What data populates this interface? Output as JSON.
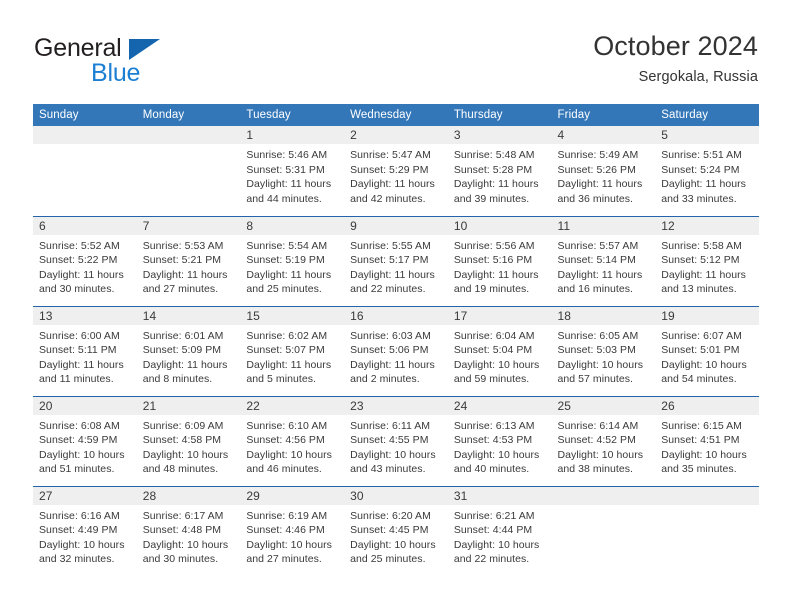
{
  "brand": {
    "name_part1": "General",
    "name_part2": "Blue",
    "triangle_color": "#1565ae",
    "blue_color": "#1c7fd3"
  },
  "header": {
    "title": "October 2024",
    "subtitle": "Sergokala, Russia"
  },
  "theme": {
    "header_blue": "#3477b8",
    "row_divider_blue": "#2265ac",
    "daynum_band": "#efefef",
    "text": "#3a3a3a"
  },
  "columns": [
    "Sunday",
    "Monday",
    "Tuesday",
    "Wednesday",
    "Thursday",
    "Friday",
    "Saturday"
  ],
  "weeks": [
    [
      {
        "day": "",
        "lines": []
      },
      {
        "day": "",
        "lines": []
      },
      {
        "day": "1",
        "lines": [
          "Sunrise: 5:46 AM",
          "Sunset: 5:31 PM",
          "Daylight: 11 hours",
          "and 44 minutes."
        ]
      },
      {
        "day": "2",
        "lines": [
          "Sunrise: 5:47 AM",
          "Sunset: 5:29 PM",
          "Daylight: 11 hours",
          "and 42 minutes."
        ]
      },
      {
        "day": "3",
        "lines": [
          "Sunrise: 5:48 AM",
          "Sunset: 5:28 PM",
          "Daylight: 11 hours",
          "and 39 minutes."
        ]
      },
      {
        "day": "4",
        "lines": [
          "Sunrise: 5:49 AM",
          "Sunset: 5:26 PM",
          "Daylight: 11 hours",
          "and 36 minutes."
        ]
      },
      {
        "day": "5",
        "lines": [
          "Sunrise: 5:51 AM",
          "Sunset: 5:24 PM",
          "Daylight: 11 hours",
          "and 33 minutes."
        ]
      }
    ],
    [
      {
        "day": "6",
        "lines": [
          "Sunrise: 5:52 AM",
          "Sunset: 5:22 PM",
          "Daylight: 11 hours",
          "and 30 minutes."
        ]
      },
      {
        "day": "7",
        "lines": [
          "Sunrise: 5:53 AM",
          "Sunset: 5:21 PM",
          "Daylight: 11 hours",
          "and 27 minutes."
        ]
      },
      {
        "day": "8",
        "lines": [
          "Sunrise: 5:54 AM",
          "Sunset: 5:19 PM",
          "Daylight: 11 hours",
          "and 25 minutes."
        ]
      },
      {
        "day": "9",
        "lines": [
          "Sunrise: 5:55 AM",
          "Sunset: 5:17 PM",
          "Daylight: 11 hours",
          "and 22 minutes."
        ]
      },
      {
        "day": "10",
        "lines": [
          "Sunrise: 5:56 AM",
          "Sunset: 5:16 PM",
          "Daylight: 11 hours",
          "and 19 minutes."
        ]
      },
      {
        "day": "11",
        "lines": [
          "Sunrise: 5:57 AM",
          "Sunset: 5:14 PM",
          "Daylight: 11 hours",
          "and 16 minutes."
        ]
      },
      {
        "day": "12",
        "lines": [
          "Sunrise: 5:58 AM",
          "Sunset: 5:12 PM",
          "Daylight: 11 hours",
          "and 13 minutes."
        ]
      }
    ],
    [
      {
        "day": "13",
        "lines": [
          "Sunrise: 6:00 AM",
          "Sunset: 5:11 PM",
          "Daylight: 11 hours",
          "and 11 minutes."
        ]
      },
      {
        "day": "14",
        "lines": [
          "Sunrise: 6:01 AM",
          "Sunset: 5:09 PM",
          "Daylight: 11 hours",
          "and 8 minutes."
        ]
      },
      {
        "day": "15",
        "lines": [
          "Sunrise: 6:02 AM",
          "Sunset: 5:07 PM",
          "Daylight: 11 hours",
          "and 5 minutes."
        ]
      },
      {
        "day": "16",
        "lines": [
          "Sunrise: 6:03 AM",
          "Sunset: 5:06 PM",
          "Daylight: 11 hours",
          "and 2 minutes."
        ]
      },
      {
        "day": "17",
        "lines": [
          "Sunrise: 6:04 AM",
          "Sunset: 5:04 PM",
          "Daylight: 10 hours",
          "and 59 minutes."
        ]
      },
      {
        "day": "18",
        "lines": [
          "Sunrise: 6:05 AM",
          "Sunset: 5:03 PM",
          "Daylight: 10 hours",
          "and 57 minutes."
        ]
      },
      {
        "day": "19",
        "lines": [
          "Sunrise: 6:07 AM",
          "Sunset: 5:01 PM",
          "Daylight: 10 hours",
          "and 54 minutes."
        ]
      }
    ],
    [
      {
        "day": "20",
        "lines": [
          "Sunrise: 6:08 AM",
          "Sunset: 4:59 PM",
          "Daylight: 10 hours",
          "and 51 minutes."
        ]
      },
      {
        "day": "21",
        "lines": [
          "Sunrise: 6:09 AM",
          "Sunset: 4:58 PM",
          "Daylight: 10 hours",
          "and 48 minutes."
        ]
      },
      {
        "day": "22",
        "lines": [
          "Sunrise: 6:10 AM",
          "Sunset: 4:56 PM",
          "Daylight: 10 hours",
          "and 46 minutes."
        ]
      },
      {
        "day": "23",
        "lines": [
          "Sunrise: 6:11 AM",
          "Sunset: 4:55 PM",
          "Daylight: 10 hours",
          "and 43 minutes."
        ]
      },
      {
        "day": "24",
        "lines": [
          "Sunrise: 6:13 AM",
          "Sunset: 4:53 PM",
          "Daylight: 10 hours",
          "and 40 minutes."
        ]
      },
      {
        "day": "25",
        "lines": [
          "Sunrise: 6:14 AM",
          "Sunset: 4:52 PM",
          "Daylight: 10 hours",
          "and 38 minutes."
        ]
      },
      {
        "day": "26",
        "lines": [
          "Sunrise: 6:15 AM",
          "Sunset: 4:51 PM",
          "Daylight: 10 hours",
          "and 35 minutes."
        ]
      }
    ],
    [
      {
        "day": "27",
        "lines": [
          "Sunrise: 6:16 AM",
          "Sunset: 4:49 PM",
          "Daylight: 10 hours",
          "and 32 minutes."
        ]
      },
      {
        "day": "28",
        "lines": [
          "Sunrise: 6:17 AM",
          "Sunset: 4:48 PM",
          "Daylight: 10 hours",
          "and 30 minutes."
        ]
      },
      {
        "day": "29",
        "lines": [
          "Sunrise: 6:19 AM",
          "Sunset: 4:46 PM",
          "Daylight: 10 hours",
          "and 27 minutes."
        ]
      },
      {
        "day": "30",
        "lines": [
          "Sunrise: 6:20 AM",
          "Sunset: 4:45 PM",
          "Daylight: 10 hours",
          "and 25 minutes."
        ]
      },
      {
        "day": "31",
        "lines": [
          "Sunrise: 6:21 AM",
          "Sunset: 4:44 PM",
          "Daylight: 10 hours",
          "and 22 minutes."
        ]
      },
      {
        "day": "",
        "lines": []
      },
      {
        "day": "",
        "lines": []
      }
    ]
  ]
}
